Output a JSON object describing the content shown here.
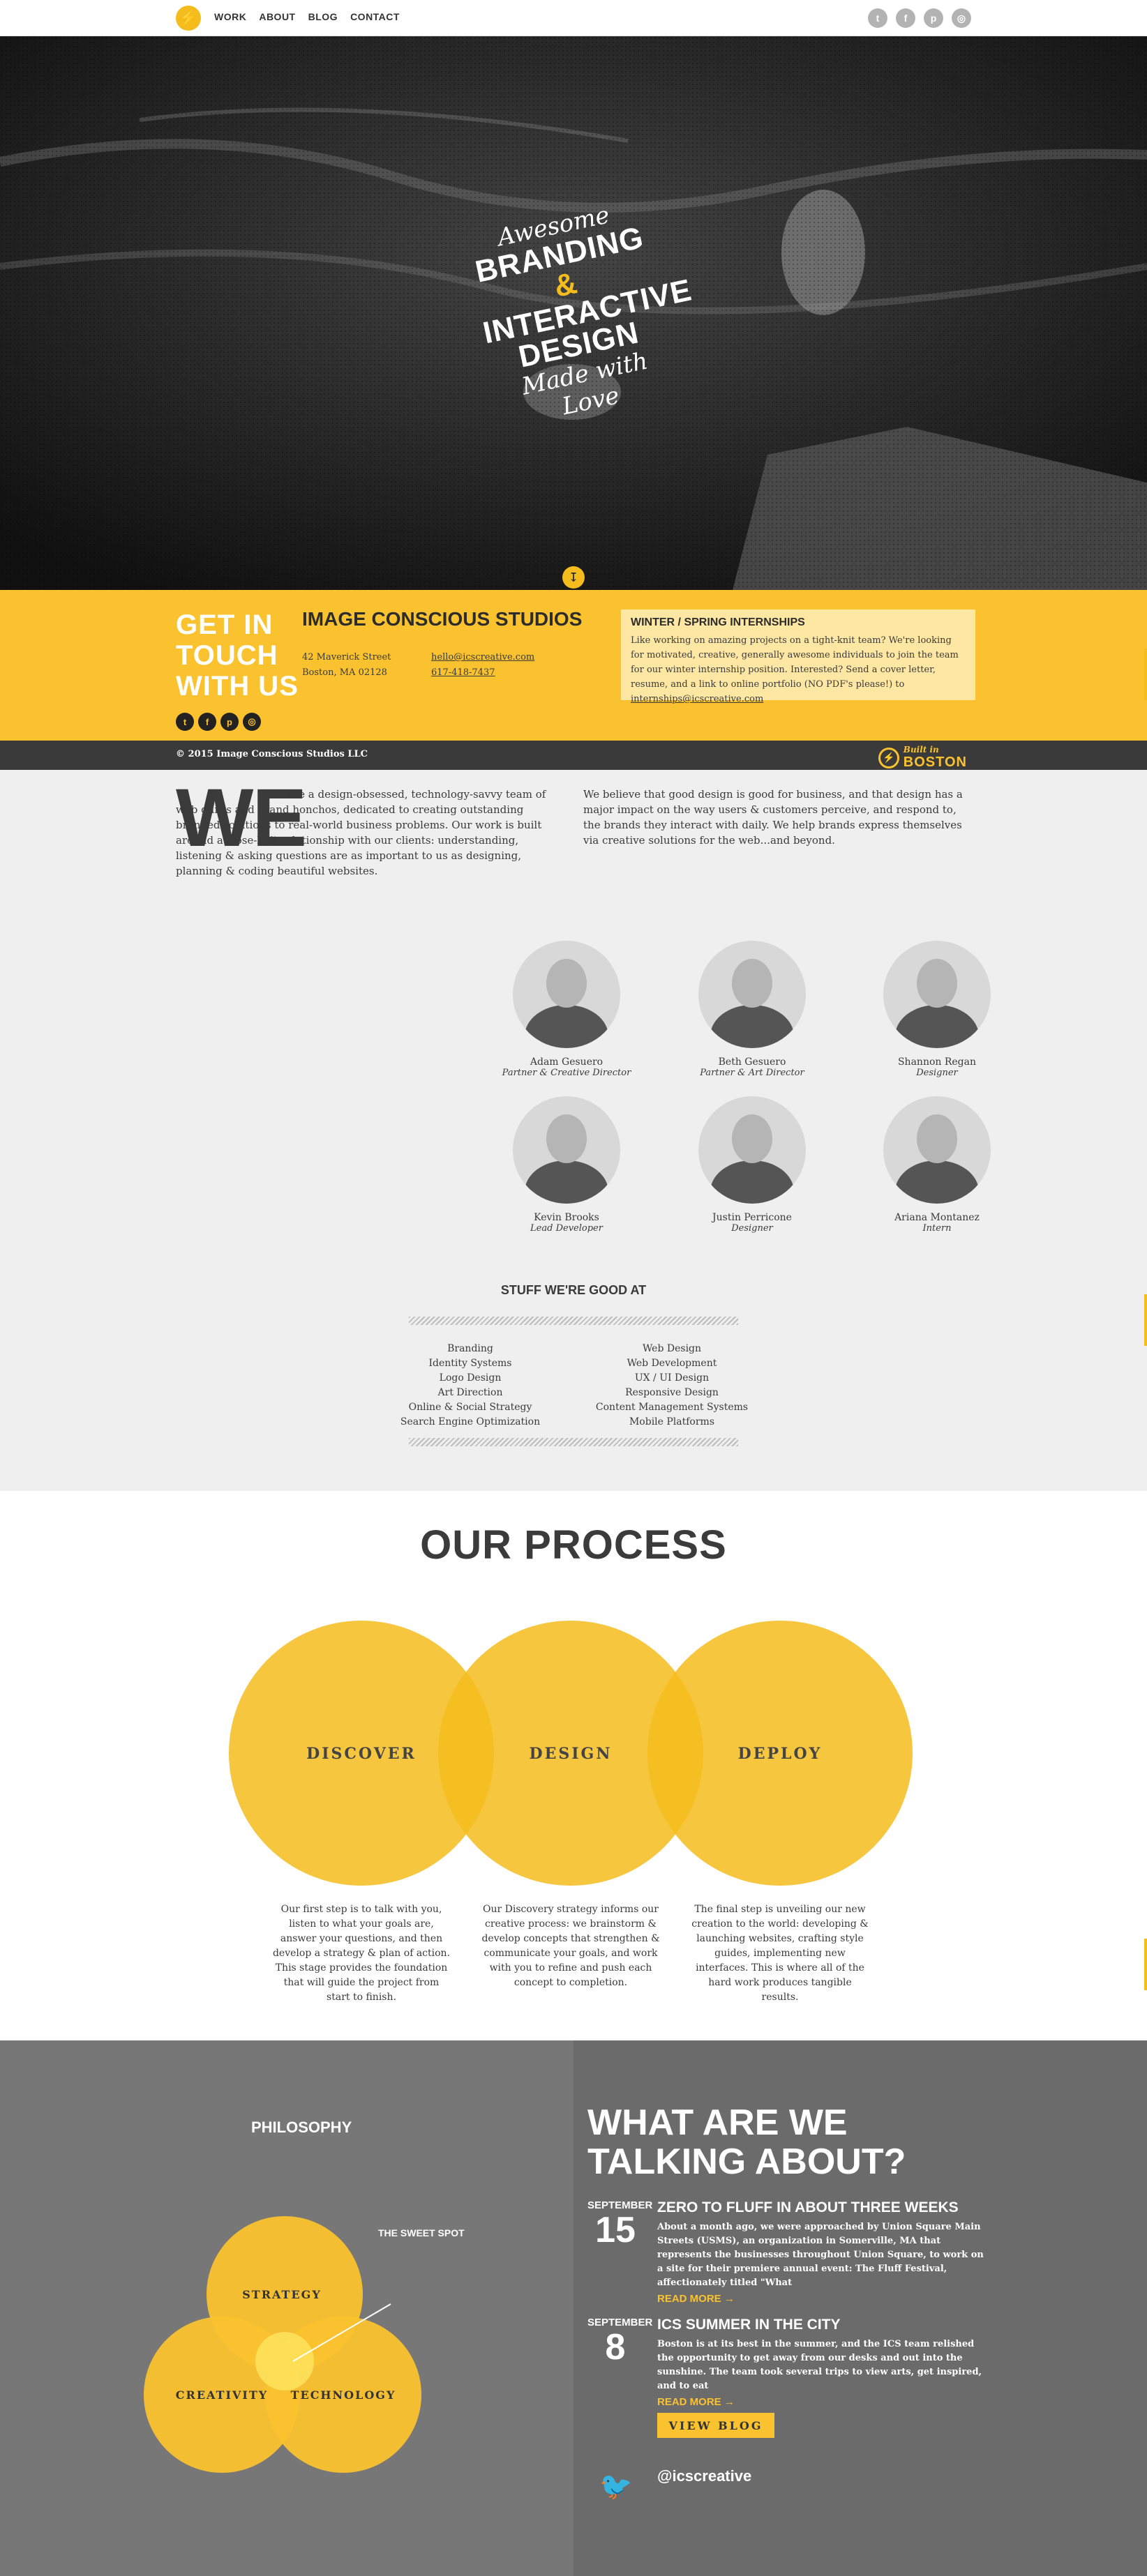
{
  "nav": {
    "logo_glyph": "⚡",
    "links": [
      "WORK",
      "ABOUT",
      "BLOG",
      "CONTACT"
    ],
    "social": [
      {
        "icon": "twitter-icon",
        "glyph": "t"
      },
      {
        "icon": "facebook-icon",
        "glyph": "f"
      },
      {
        "icon": "pinterest-icon",
        "glyph": "p"
      },
      {
        "icon": "instagram-icon",
        "glyph": "◎"
      }
    ]
  },
  "hero": {
    "line1": "Awesome",
    "line2": "BRANDING",
    "amp": "&",
    "line3": "INTERACTIVE",
    "line4": "DESIGN",
    "line5": "Made with Love",
    "scroll_glyph": "↧"
  },
  "contact": {
    "heading_lines": [
      "GET IN",
      "TOUCH",
      "WITH US"
    ],
    "studio": "IMAGE CONSCIOUS STUDIOS",
    "address_line1": "42 Maverick Street",
    "address_line2": "Boston, MA 02128",
    "email": "hello@icscreative.com",
    "phone": "617-418-7437",
    "internship_title": "WINTER / SPRING INTERNSHIPS",
    "internship_text": "Like working on amazing projects on a tight-knit team? We're looking for motivated, creative, generally awesome individuals to join the team for our winter internship position. Interested? Send a cover letter, resume, and a link to online portfolio (NO PDF's please!) to",
    "internship_email": "internships@icscreative.com",
    "social_glyphs": [
      "t",
      "f",
      "p",
      "◎"
    ]
  },
  "footer_strip": {
    "copyright": "© 2015 Image Conscious Studios LLC",
    "built_in": "Built in",
    "city": "BOSTON",
    "badge_glyph": "⚡"
  },
  "about": {
    "we": "WE",
    "left_text": "are a design-obsessed, technology-savvy team of web gurus and brand honchos, dedicated to creating outstanding branded solutions to real-world business problems. Our work is built around a close-knit relationship with our clients: understanding, listening & asking questions are as important to us as designing, planning & coding beautiful websites.",
    "right_text": "We believe that good design is good for business, and that design has a major impact on the way users & customers perceive, and respond to, the brands they interact with daily. We help brands express themselves via creative solutions for the web...and beyond.",
    "team": [
      {
        "name": "Adam Gesuero",
        "role": "Partner & Creative Director"
      },
      {
        "name": "Beth Gesuero",
        "role": "Partner & Art Director"
      },
      {
        "name": "Shannon Regan",
        "role": "Designer"
      },
      {
        "name": "Kevin Brooks",
        "role": "Lead Developer"
      },
      {
        "name": "Justin Perricone",
        "role": "Designer"
      },
      {
        "name": "Ariana Montanez",
        "role": "Intern"
      }
    ],
    "skills_title": "STUFF WE'RE GOOD AT",
    "skills_left": [
      "Branding",
      "Identity Systems",
      "Logo Design",
      "Art Direction",
      "Online & Social Strategy",
      "Search Engine Optimization"
    ],
    "skills_right": [
      "Web Design",
      "Web Development",
      "UX / UI Design",
      "Responsive Design",
      "Content Management Systems",
      "Mobile Platforms"
    ]
  },
  "process": {
    "title": "OUR PROCESS",
    "steps": [
      {
        "label": "DISCOVER",
        "text": "Our first step is to talk with you, listen to what your goals are, answer your questions, and then develop a strategy & plan of action. This stage provides the foundation that will guide the project from start to finish."
      },
      {
        "label": "DESIGN",
        "text": "Our Discovery strategy informs our creative process: we brainstorm & develop concepts that strengthen & communicate your goals, and work with you to refine and push each concept to completion."
      },
      {
        "label": "DEPLOY",
        "text": "The final step is unveiling our new creation to the world: developing & launching websites, crafting style guides, implementing new interfaces. This is where all of the hard work produces tangible results."
      }
    ],
    "colors": {
      "circle": "#f4bc1c",
      "overlap": "#f0ad0a"
    }
  },
  "philosophy": {
    "title": "PHILOSOPHY",
    "circles": [
      "STRATEGY",
      "CREATIVITY",
      "TECHNOLOGY"
    ],
    "sweet_spot": "THE SWEET SPOT"
  },
  "talking": {
    "title": "WHAT ARE WE TALKING ABOUT?",
    "posts": [
      {
        "month": "SEPTEMBER",
        "day": "15",
        "title": "ZERO TO FLUFF IN ABOUT THREE WEEKS",
        "excerpt": "About a month ago, we were approached by Union Square Main Streets (USMS), an organization in Somerville, MA that represents the businesses throughout Union Square, to work on a site for their premiere annual event: The Fluff Festival, affectionately titled \"What",
        "more": "READ MORE →"
      },
      {
        "month": "SEPTEMBER",
        "day": "8",
        "title": "ICS SUMMER IN THE CITY",
        "excerpt": "Boston is at its best in the summer, and the ICS team relished the opportunity to get away from our desks and out into the sunshine. The team took several trips to view arts, get inspired, and to eat",
        "more": "READ MORE →"
      }
    ],
    "view_blog": "VIEW BLOG",
    "twitter_glyph": "🐦",
    "handle": "@icscreative"
  }
}
